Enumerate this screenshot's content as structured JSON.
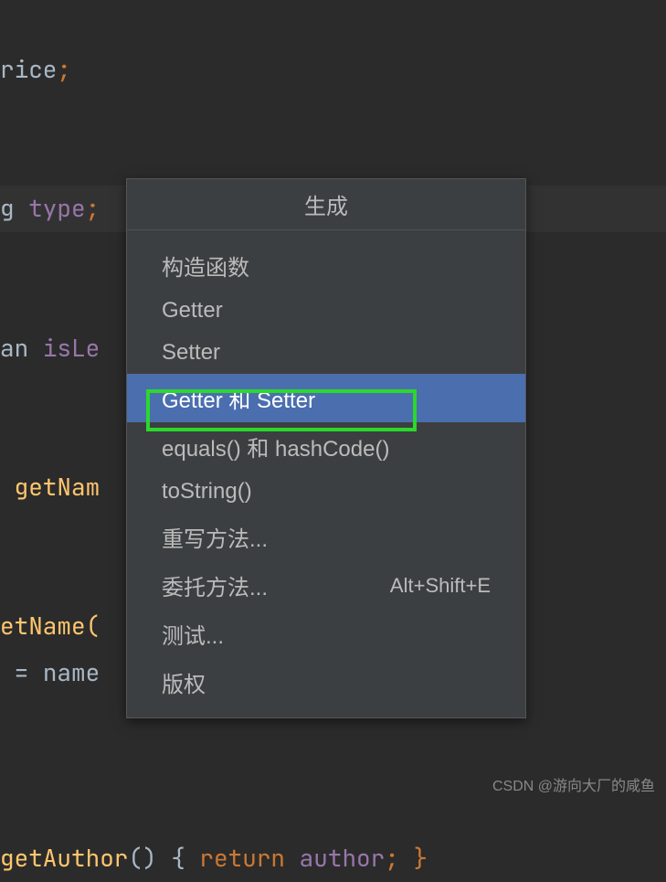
{
  "code": {
    "line1_text": "rice",
    "line1_semi": ";",
    "line3_pre": "g ",
    "line3_type": "type",
    "line3_semi": ";",
    "line5_pre": "an ",
    "line5_text": "isLe",
    "line7_pre": " ",
    "line7_text": "getNam",
    "line9_text": "etName(",
    "line10_pre": " = ",
    "line10_text": "name",
    "line12_text": "getAuthor",
    "line12_paren": "() ",
    "line12_brace": "{ ",
    "line12_return": "return",
    "line12_semi": " ",
    "line12_author": "author",
    "line12_end": "; }"
  },
  "popup": {
    "title": "生成",
    "items": [
      {
        "label": "构造函数",
        "shortcut": ""
      },
      {
        "label": "Getter",
        "shortcut": ""
      },
      {
        "label": "Setter",
        "shortcut": ""
      },
      {
        "label": "Getter 和 Setter",
        "shortcut": ""
      },
      {
        "label": "equals() 和 hashCode()",
        "shortcut": ""
      },
      {
        "label": "toString()",
        "shortcut": ""
      },
      {
        "label": "重写方法...",
        "shortcut": ""
      },
      {
        "label": "委托方法...",
        "shortcut": "Alt+Shift+E"
      },
      {
        "label": "测试...",
        "shortcut": ""
      },
      {
        "label": "版权",
        "shortcut": ""
      }
    ],
    "selectedIndex": 3
  },
  "watermark": "CSDN @游向大厂的咸鱼"
}
